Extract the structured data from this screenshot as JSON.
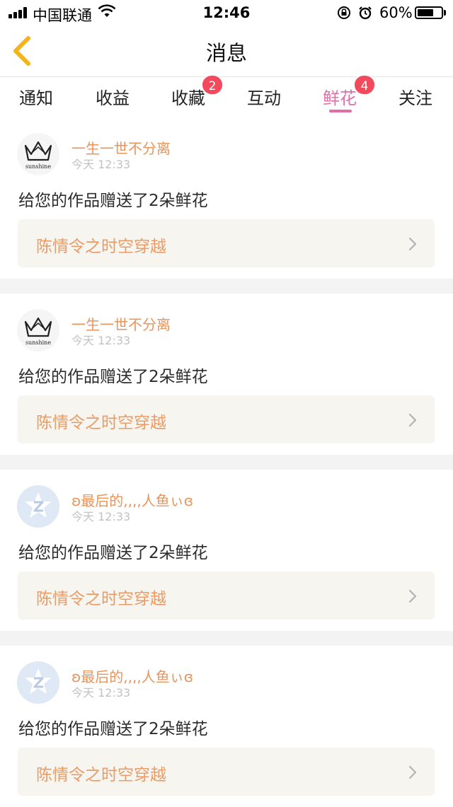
{
  "status_bar": {
    "carrier": "中国联通",
    "time": "12:46",
    "battery": "60%"
  },
  "nav": {
    "title": "消息",
    "back_icon": "chevron-left-icon"
  },
  "tabs": [
    {
      "label": "通知",
      "badge": "",
      "active": false
    },
    {
      "label": "收益",
      "badge": "",
      "active": false
    },
    {
      "label": "收藏",
      "badge": "2",
      "active": false
    },
    {
      "label": "互动",
      "badge": "",
      "active": false
    },
    {
      "label": "鲜花",
      "badge": "4",
      "active": true
    },
    {
      "label": "关注",
      "badge": "",
      "active": false
    }
  ],
  "messages": [
    {
      "avatar": "crown-avatar",
      "avatar_text": "sunshine",
      "user": "一生一世不分离",
      "time": "今天 12:33",
      "text": "给您的作品赠送了2朵鲜花",
      "work": "陈情令之时空穿越"
    },
    {
      "avatar": "crown-avatar",
      "avatar_text": "sunshine",
      "user": "一生一世不分离",
      "time": "今天 12:33",
      "text": "给您的作品赠送了2朵鲜花",
      "work": "陈情令之时空穿越"
    },
    {
      "avatar": "qq-avatar",
      "avatar_text": "",
      "user": "ʚ最后的,,,,人鱼ぃɞ",
      "time": "今天 12:33",
      "text": "给您的作品赠送了2朵鲜花",
      "work": "陈情令之时空穿越"
    },
    {
      "avatar": "qq-avatar",
      "avatar_text": "",
      "user": "ʚ最后的,,,,人鱼ぃɞ",
      "time": "今天 12:33",
      "text": "给您的作品赠送了2朵鲜花",
      "work": "陈情令之时空穿越"
    }
  ],
  "colors": {
    "accent_pink": "#e06fa5",
    "badge_red": "#f24a5c",
    "username_orange": "#e9945a",
    "back_yellow": "#f2b51c"
  }
}
